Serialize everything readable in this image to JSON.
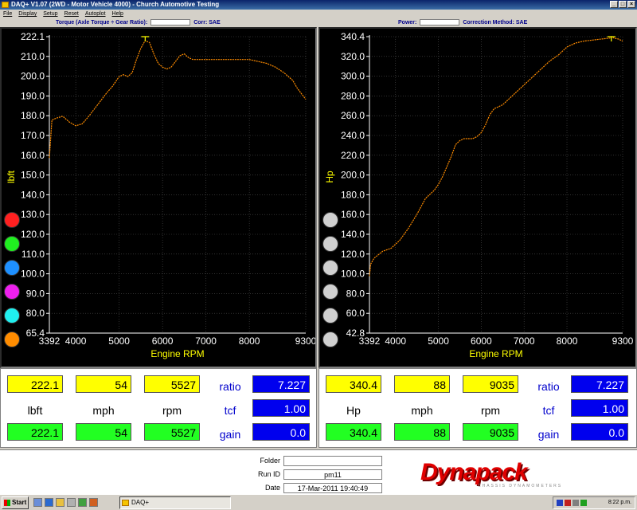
{
  "window": {
    "title": "DAQ+ V1.07 (2WD - Motor Vehicle 4000) - Church Automotive Testing"
  },
  "menu": [
    "File",
    "Display",
    "Setup",
    "Reset",
    "Autoplot",
    "Help"
  ],
  "header_left": {
    "title": "Torque (Axle Torque ÷ Gear Ratio):",
    "corr_label": "Corr: SAE"
  },
  "header_right": {
    "power_label": "Power:",
    "correction_label": "Correction Method: SAE"
  },
  "colors": {
    "trace": "#ff8c00",
    "grid": "#505050",
    "axis_text": "#ffffff",
    "axis_title": "#ffff00",
    "readout_yellow": "#ffff00",
    "readout_green": "#22ff22",
    "readout_blue": "#0000ee",
    "logo_red": "#e00000"
  },
  "left_chart": {
    "ylabel": "lbft",
    "xlabel": "Engine RPM",
    "yticks": [
      "222.1",
      "210.0",
      "200.0",
      "190.0",
      "180.0",
      "170.0",
      "160.0",
      "150.0",
      "140.0",
      "130.0",
      "120.0",
      "110.0",
      "100.0",
      "90.0",
      "80.0",
      "65.4"
    ],
    "xticks": [
      "3392",
      "4000",
      "5000",
      "6000",
      "7000",
      "8000",
      "9300"
    ],
    "marker_dots": [
      "#ff2020",
      "#20ee20",
      "#1e90ff",
      "#ee20ee",
      "#20eeee",
      "#ff8c00"
    ]
  },
  "right_chart": {
    "ylabel": "Hp",
    "xlabel": "Engine RPM",
    "yticks": [
      "340.4",
      "320.0",
      "300.0",
      "280.0",
      "260.0",
      "240.0",
      "220.0",
      "200.0",
      "180.0",
      "160.0",
      "140.0",
      "120.0",
      "100.0",
      "80.0",
      "60.0",
      "42.8"
    ],
    "xticks": [
      "3392",
      "4000",
      "5000",
      "6000",
      "7000",
      "8000",
      "9300"
    ],
    "marker_dots": [
      "#d0d0d0",
      "#d0d0d0",
      "#d0d0d0",
      "#d0d0d0",
      "#d0d0d0",
      "#d0d0d0"
    ]
  },
  "chart_data": [
    {
      "type": "line",
      "xlabel": "Engine RPM",
      "ylabel": "lbft",
      "xlim": [
        3392,
        9300
      ],
      "ylim": [
        65.4,
        222.1
      ],
      "series": [
        {
          "x": [
            3392,
            3450,
            3550,
            3700,
            3850,
            4000,
            4150,
            4300,
            4500,
            4700,
            4850,
            5000,
            5100,
            5200,
            5300,
            5400,
            5500,
            5600,
            5700,
            5800,
            5900,
            6000,
            6100,
            6200,
            6300,
            6400,
            6500,
            6600,
            6700,
            6800,
            7000,
            7200,
            7400,
            7600,
            7800,
            8000,
            8200,
            8400,
            8600,
            8800,
            9000,
            9100,
            9200,
            9300
          ],
          "y": [
            158,
            178,
            179,
            180,
            177,
            175,
            176,
            180,
            186,
            192,
            196,
            201,
            202,
            201,
            203,
            210,
            216,
            220,
            219,
            213,
            208,
            206,
            205,
            206,
            209,
            212,
            213,
            211,
            210,
            210,
            210,
            210,
            210,
            210,
            210,
            210,
            209,
            208,
            206,
            203,
            199,
            195,
            192,
            189
          ]
        }
      ]
    },
    {
      "type": "line",
      "xlabel": "Engine RPM",
      "ylabel": "Hp",
      "xlim": [
        3392,
        9300
      ],
      "ylim": [
        42.8,
        340.4
      ],
      "series": [
        {
          "x": [
            3392,
            3420,
            3500,
            3700,
            3900,
            4100,
            4300,
            4500,
            4700,
            4900,
            5000,
            5100,
            5200,
            5300,
            5400,
            5500,
            5600,
            5700,
            5800,
            5900,
            6000,
            6100,
            6200,
            6300,
            6400,
            6500,
            6600,
            6800,
            7000,
            7200,
            7400,
            7600,
            7800,
            8000,
            8200,
            8400,
            8600,
            8800,
            9000,
            9035,
            9100,
            9200,
            9300
          ],
          "y": [
            100,
            112,
            118,
            125,
            128,
            136,
            148,
            162,
            178,
            186,
            192,
            200,
            210,
            220,
            232,
            236,
            238,
            238,
            238,
            240,
            244,
            252,
            262,
            268,
            270,
            272,
            276,
            284,
            292,
            300,
            308,
            316,
            322,
            330,
            334,
            336,
            337,
            338,
            339,
            340.4,
            339,
            338,
            336
          ]
        }
      ]
    }
  ],
  "readouts_left": {
    "top": [
      "222.1",
      "54",
      "5527"
    ],
    "units": [
      "lbft",
      "mph",
      "rpm"
    ],
    "bottom": [
      "222.1",
      "54",
      "5527"
    ],
    "params": [
      {
        "label": "ratio",
        "value": "7.227"
      },
      {
        "label": "tcf",
        "value": "1.00"
      },
      {
        "label": "gain",
        "value": "0.0"
      }
    ]
  },
  "readouts_right": {
    "top": [
      "340.4",
      "88",
      "9035"
    ],
    "units": [
      "Hp",
      "mph",
      "rpm"
    ],
    "bottom": [
      "340.4",
      "88",
      "9035"
    ],
    "params": [
      {
        "label": "ratio",
        "value": "7.227"
      },
      {
        "label": "tcf",
        "value": "1.00"
      },
      {
        "label": "gain",
        "value": "0.0"
      }
    ]
  },
  "fields": {
    "folder_label": "Folder",
    "folder_value": "",
    "runid_label": "Run ID",
    "runid_value": "pm11",
    "date_label": "Date",
    "date_value": "17-Mar-2011 19:40:49"
  },
  "logo": {
    "text": "Dynapack",
    "sub": "CHASSIS DYNAMOMETERS"
  },
  "taskbar": {
    "start_label": "Start",
    "task_label": "DAQ+",
    "clock": "8:22 p.m."
  }
}
